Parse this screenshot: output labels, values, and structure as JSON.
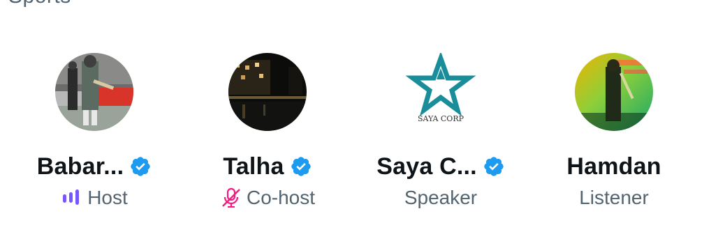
{
  "section": {
    "title": "Sports"
  },
  "participants": [
    {
      "name": "Babar...",
      "verified": true,
      "role": "Host",
      "role_icon": "speaking-bars-icon",
      "avatar": "cricketer-batting-avatar"
    },
    {
      "name": "Talha",
      "verified": true,
      "role": "Co-host",
      "role_icon": "mic-muted-icon",
      "avatar": "night-waterfront-avatar"
    },
    {
      "name": "Saya C...",
      "verified": true,
      "role": "Speaker",
      "role_icon": "",
      "avatar": "saya-corp-logo-avatar",
      "avatar_logo_text": "SAYA CORP"
    },
    {
      "name": "Hamdan",
      "verified": false,
      "role": "Listener",
      "role_icon": "",
      "avatar": "stage-lights-avatar"
    }
  ],
  "colors": {
    "text_primary": "#0f1419",
    "text_secondary": "#536471",
    "verified_blue": "#1d9bf0",
    "host_purple": "#7856ff",
    "cohost_pink": "#f91880",
    "logo_teal": "#1a8d9a"
  }
}
